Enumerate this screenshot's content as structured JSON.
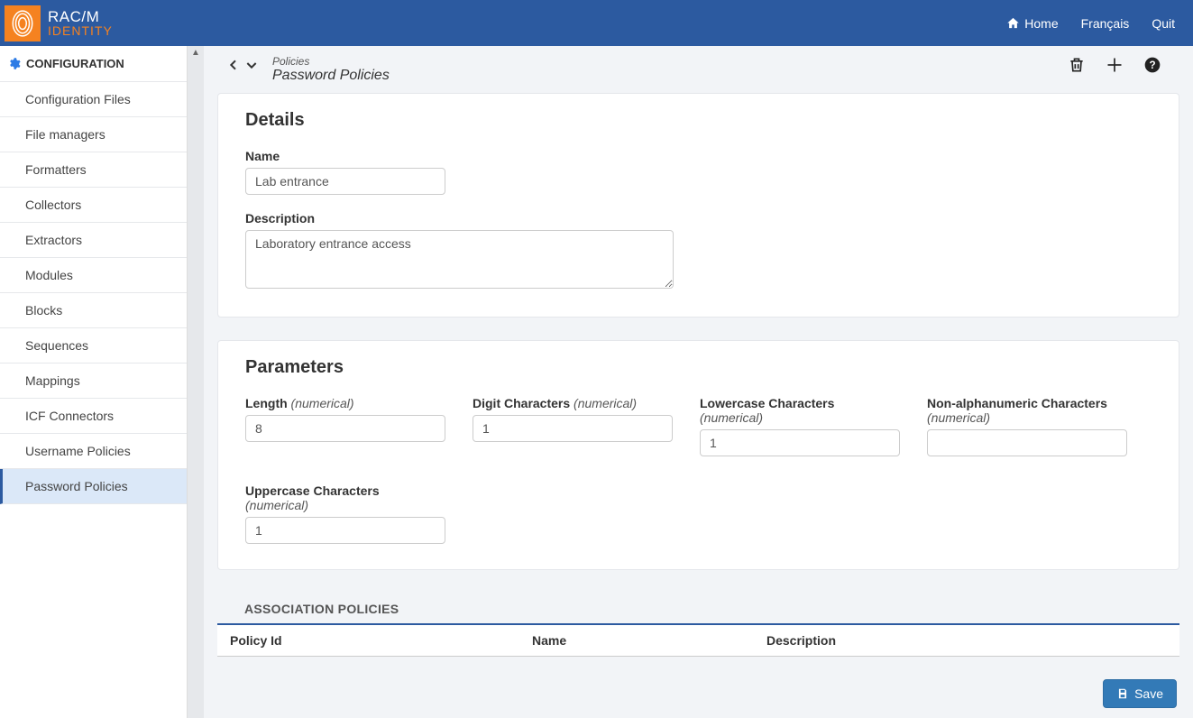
{
  "topbar": {
    "brand_primary": "RAC/M",
    "brand_secondary": "IDENTITY",
    "home_label": "Home",
    "lang_label": "Français",
    "quit_label": "Quit"
  },
  "sidebar": {
    "section_title": "CONFIGURATION",
    "items": [
      {
        "label": "Configuration Files"
      },
      {
        "label": "File managers"
      },
      {
        "label": "Formatters"
      },
      {
        "label": "Collectors"
      },
      {
        "label": "Extractors"
      },
      {
        "label": "Modules"
      },
      {
        "label": "Blocks"
      },
      {
        "label": "Sequences"
      },
      {
        "label": "Mappings"
      },
      {
        "label": "ICF Connectors"
      },
      {
        "label": "Username Policies"
      },
      {
        "label": "Password Policies"
      }
    ],
    "active_index": 11
  },
  "breadcrumb": {
    "parent": "Policies",
    "current": "Password Policies"
  },
  "details": {
    "panel_title": "Details",
    "name_label": "Name",
    "name_value": "Lab entrance",
    "description_label": "Description",
    "description_value": "Laboratory entrance access"
  },
  "parameters": {
    "panel_title": "Parameters",
    "numeric_hint": "(numerical)",
    "length_label": "Length",
    "length_value": "8",
    "digit_label": "Digit Characters",
    "digit_value": "1",
    "lowercase_label": "Lowercase Characters",
    "lowercase_value": "1",
    "nonalpha_label": "Non-alphanumeric Characters",
    "nonalpha_value": "",
    "uppercase_label": "Uppercase Characters",
    "uppercase_value": "1"
  },
  "assoc": {
    "title": "ASSOCIATION POLICIES",
    "col_policy_id": "Policy Id",
    "col_name": "Name",
    "col_description": "Description"
  },
  "actions": {
    "save_label": "Save"
  }
}
